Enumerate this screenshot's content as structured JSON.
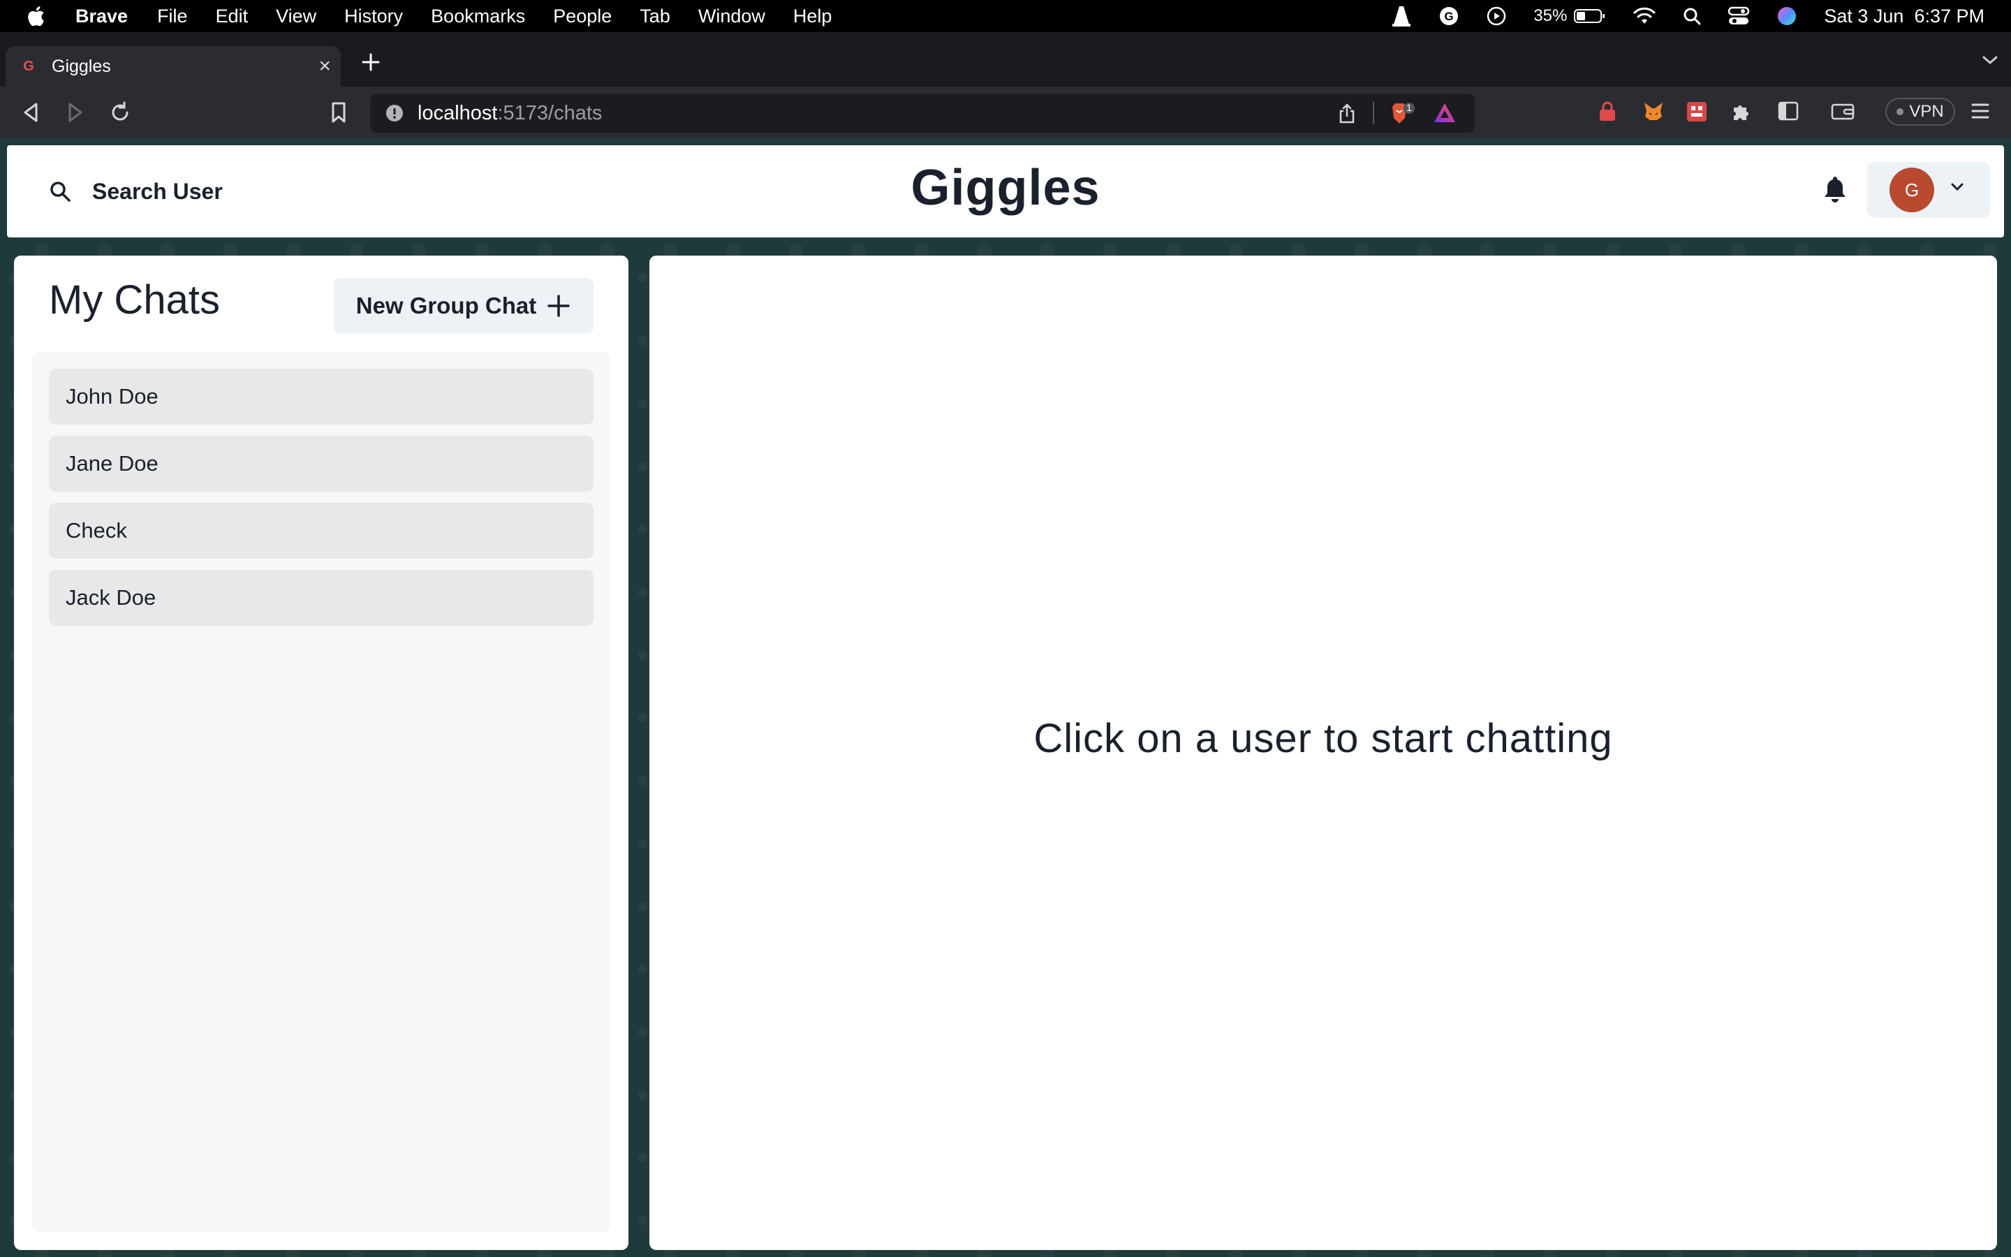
{
  "menubar": {
    "app_name": "Brave",
    "items": [
      "File",
      "Edit",
      "View",
      "History",
      "Bookmarks",
      "People",
      "Tab",
      "Window",
      "Help"
    ],
    "battery": "35%",
    "datetime": "Sat 3 Jun  6:37 PM"
  },
  "browser": {
    "tab_title": "Giggles",
    "tab_favicon": "G",
    "url_host": "localhost",
    "url_rest": ":5173/chats",
    "shields_count": "1",
    "vpn_label": "VPN"
  },
  "header": {
    "search_label": "Search User",
    "brand": "Giggles",
    "avatar_initial": "G",
    "avatar_color": "#b94a30"
  },
  "sidebar": {
    "title": "My Chats",
    "new_group_label": "New Group Chat",
    "chats": [
      "John Doe",
      "Jane Doe",
      "Check",
      "Jack Doe"
    ]
  },
  "chat": {
    "empty_message": "Click on a user to start chatting"
  }
}
